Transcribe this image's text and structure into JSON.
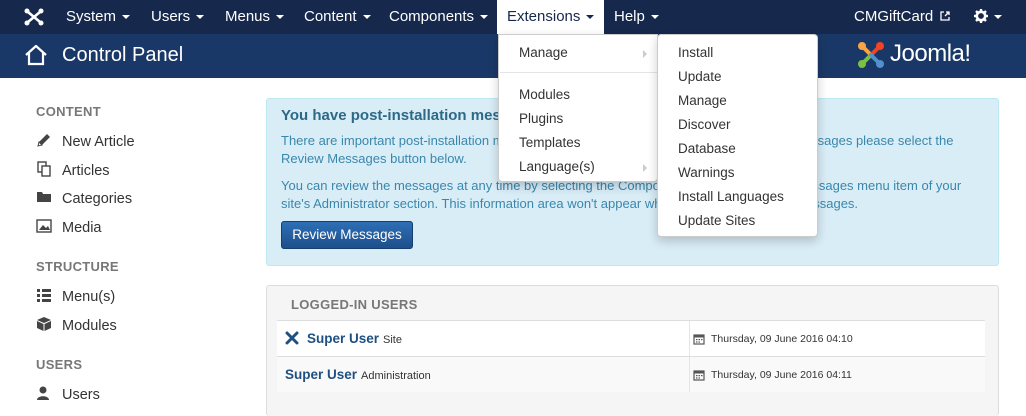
{
  "navbar": {
    "logo_icon": "joomla-icon",
    "items": [
      {
        "label": "System"
      },
      {
        "label": "Users"
      },
      {
        "label": "Menus"
      },
      {
        "label": "Content"
      },
      {
        "label": "Components"
      },
      {
        "label": "Extensions"
      },
      {
        "label": "Help"
      }
    ],
    "site_link": "CMGiftCard",
    "settings_icon": "gear-icon"
  },
  "header": {
    "title": "Control Panel",
    "brand": "Joomla!"
  },
  "sidebar": {
    "sections": [
      {
        "heading": "CONTENT",
        "items": [
          "New Article",
          "Articles",
          "Categories",
          "Media"
        ]
      },
      {
        "heading": "STRUCTURE",
        "items": [
          "Menu(s)",
          "Modules"
        ]
      },
      {
        "heading": "USERS",
        "items": [
          "Users"
        ]
      }
    ]
  },
  "alert": {
    "title": "You have post-installation messages",
    "p1": "There are important post-installation messages that require your attention. To view these messages please select the Review Messages button below.",
    "p2": "You can review the messages at any time by selecting the Components, Post-installation Messages menu item of your site's Administrator section. This information area won't appear when you have hidden all messages.",
    "button": "Review Messages"
  },
  "logged_in": {
    "heading": "LOGGED-IN USERS",
    "rows": [
      {
        "name": "Super User",
        "client": "Site",
        "date": "Thursday, 09 June 2016 04:10"
      },
      {
        "name": "Super User",
        "client": "Administration",
        "date": "Thursday, 09 June 2016 04:11"
      }
    ]
  },
  "extensions_menu": {
    "items": [
      "Manage",
      "Modules",
      "Plugins",
      "Templates",
      "Language(s)"
    ]
  },
  "install_menu": {
    "items": [
      "Install",
      "Update",
      "Manage",
      "Discover",
      "Database",
      "Warnings",
      "Install Languages",
      "Update Sites"
    ]
  }
}
